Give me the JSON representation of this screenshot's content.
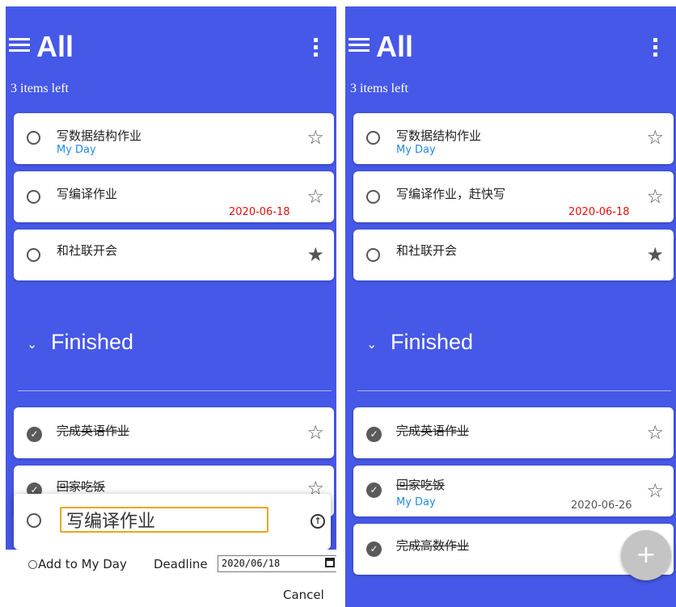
{
  "header": {
    "title": "All"
  },
  "count_label": "3 items left",
  "finished_label": "Finished",
  "left": {
    "tasks": [
      {
        "text": "写数据结构作业",
        "tag": "My Day",
        "star": "☆"
      },
      {
        "text": "写编译作业",
        "date": "2020-06-18",
        "star": "☆"
      },
      {
        "text": "和社联开会",
        "star": "★"
      }
    ],
    "finished": [
      {
        "text": "完成英语作业",
        "star": "☆"
      },
      {
        "text": "回家吃饭",
        "star": "☆"
      }
    ],
    "editor": {
      "value": "写编译作业",
      "add_my_day": "Add to My Day",
      "deadline_label": "Deadline",
      "deadline_value": "2020/06/18",
      "cancel": "Cancel"
    }
  },
  "right": {
    "tasks": [
      {
        "text": "写数据结构作业",
        "tag": "My Day",
        "star": "☆"
      },
      {
        "text": "写编译作业，赶快写",
        "date": "2020-06-18",
        "star": "☆"
      },
      {
        "text": "和社联开会",
        "star": "★"
      }
    ],
    "finished": [
      {
        "text": "完成英语作业",
        "star": "☆"
      },
      {
        "text": "回家吃饭",
        "tag": "My Day",
        "date": "2020-06-26",
        "star": "☆"
      },
      {
        "text": "完成高数作业"
      }
    ],
    "fab_label": "+"
  },
  "colors": {
    "background": "#4658e8",
    "accent_date": "#e01010",
    "tag": "#2389e6",
    "input_border": "#e6a81f"
  },
  "icons": [
    "menu-icon",
    "more-vert-icon",
    "circle-icon",
    "check-circle-icon",
    "star-outline-icon",
    "star-filled-icon",
    "chevron-down-icon",
    "upload-icon",
    "calendar-icon",
    "sun-icon",
    "plus-icon"
  ]
}
